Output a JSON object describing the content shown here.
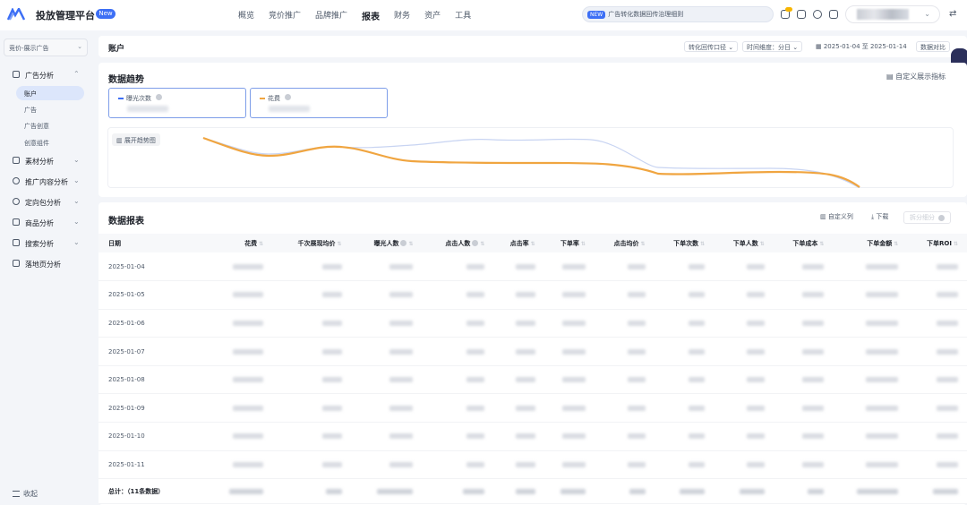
{
  "brand": {
    "title": "投放管理平台",
    "badge": "New"
  },
  "top_menu": [
    "概览",
    "竞价推广",
    "品牌推广",
    "报表",
    "财务",
    "资产",
    "工具"
  ],
  "top_menu_active": "报表",
  "notice": {
    "tag": "NEW",
    "text": "广告转化数据回传治理细则"
  },
  "sidebar": {
    "account_select": "竞价-展示广告",
    "groups": [
      {
        "label": "广告分析",
        "icon": "chart-icon",
        "children": [
          "账户",
          "广告",
          "广告创意",
          "创意组件"
        ]
      },
      {
        "label": "素材分析",
        "icon": "image-icon"
      },
      {
        "label": "推广内容分析",
        "icon": "target-icon"
      },
      {
        "label": "定向包分析",
        "icon": "location-icon"
      },
      {
        "label": "商品分析",
        "icon": "bag-icon"
      },
      {
        "label": "搜索分析",
        "icon": "search-icon"
      },
      {
        "label": "落地页分析",
        "icon": "page-icon"
      }
    ],
    "active_child": "账户",
    "collapse_label": "收起"
  },
  "header": {
    "title": "账户",
    "conversion_select": "转化回传口径",
    "granularity": "时间维度：分日",
    "date_range": "2025-01-04 至 2025-01-14",
    "compare_btn": "数据对比"
  },
  "trend": {
    "title": "数据趋势",
    "custom_metric_link": "自定义展示指标",
    "metrics": [
      {
        "label": "曝光次数",
        "color": "#3d6ff5"
      },
      {
        "label": "花费",
        "color": "#f0a540"
      }
    ],
    "expand_btn": "展开趋势图"
  },
  "report": {
    "title": "数据报表",
    "custom_cols": "自定义列",
    "download": "下载",
    "split": "拆分细分",
    "columns": [
      "日期",
      "花费",
      "千次展现均价",
      "曝光人数",
      "点击人数",
      "点击率",
      "下单率",
      "点击均价",
      "下单次数",
      "下单人数",
      "下单成本",
      "下单金额",
      "下单ROI"
    ],
    "rows": [
      "2025-01-04",
      "2025-01-05",
      "2025-01-06",
      "2025-01-07",
      "2025-01-08",
      "2025-01-09",
      "2025-01-10",
      "2025-01-11"
    ],
    "total_label": "总计：（11条数据）"
  }
}
